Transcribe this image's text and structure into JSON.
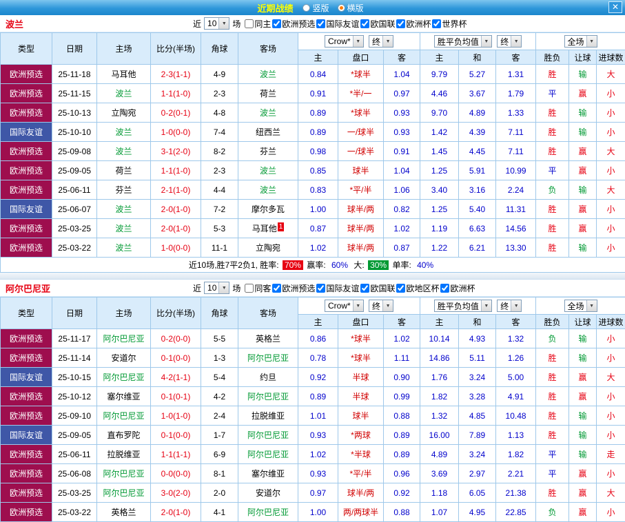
{
  "titlebar": {
    "title": "近期战绩",
    "vertical": "竖版",
    "horizontal": "横版",
    "close": "✕"
  },
  "table_head": {
    "col_type": "类型",
    "col_date": "日期",
    "col_home": "主场",
    "col_score": "比分(半场)",
    "col_corner": "角球",
    "col_away": "客场",
    "odds_select": "Crow*",
    "odds_final": "终",
    "avg_select": "胜平负均值",
    "avg_final": "终",
    "scope_select": "全场",
    "sub": [
      "主",
      "盘口",
      "客",
      "主",
      "和",
      "客",
      "胜负",
      "让球",
      "进球数"
    ]
  },
  "sections": [
    {
      "team": "波兰",
      "filter": {
        "near": "近",
        "count": "10",
        "games": "场",
        "checkboxes": [
          {
            "label": "同主",
            "checked": false
          },
          {
            "label": "欧洲预选",
            "checked": true
          },
          {
            "label": "国际友谊",
            "checked": true
          },
          {
            "label": "欧国联",
            "checked": true
          },
          {
            "label": "欧洲杯",
            "checked": true
          },
          {
            "label": "世界杯",
            "checked": true
          }
        ]
      },
      "rows": [
        {
          "type": "欧洲预选",
          "tc": "ep",
          "date": "25-11-18",
          "home": "马耳他",
          "hf": false,
          "score": "2-3(1-1)",
          "corner": "4-9",
          "away": "波兰",
          "af": true,
          "o1": "0.84",
          "oh": "*球半",
          "o2": "1.04",
          "e1": "9.79",
          "ex": "5.27",
          "e2": "1.31",
          "rs": "胜",
          "rsc": "red",
          "rh": "输",
          "rhc": "green",
          "rg": "大",
          "rgc": "red"
        },
        {
          "type": "欧洲预选",
          "tc": "ep",
          "date": "25-11-15",
          "home": "波兰",
          "hf": true,
          "score": "1-1(1-0)",
          "corner": "2-3",
          "away": "荷兰",
          "af": false,
          "o1": "0.91",
          "oh": "*半/一",
          "o2": "0.97",
          "e1": "4.46",
          "ex": "3.67",
          "e2": "1.79",
          "rs": "平",
          "rsc": "blue",
          "rh": "赢",
          "rhc": "red",
          "rg": "小",
          "rgc": "red"
        },
        {
          "type": "欧洲预选",
          "tc": "ep",
          "date": "25-10-13",
          "home": "立陶宛",
          "hf": false,
          "score": "0-2(0-1)",
          "corner": "4-8",
          "away": "波兰",
          "af": true,
          "o1": "0.89",
          "oh": "*球半",
          "o2": "0.93",
          "e1": "9.70",
          "ex": "4.89",
          "e2": "1.33",
          "rs": "胜",
          "rsc": "red",
          "rh": "输",
          "rhc": "green",
          "rg": "小",
          "rgc": "red"
        },
        {
          "type": "国际友谊",
          "tc": "if",
          "date": "25-10-10",
          "home": "波兰",
          "hf": true,
          "score": "1-0(0-0)",
          "corner": "7-4",
          "away": "纽西兰",
          "af": false,
          "o1": "0.89",
          "oh": "一/球半",
          "o2": "0.93",
          "e1": "1.42",
          "ex": "4.39",
          "e2": "7.11",
          "rs": "胜",
          "rsc": "red",
          "rh": "输",
          "rhc": "green",
          "rg": "小",
          "rgc": "red"
        },
        {
          "type": "欧洲预选",
          "tc": "ep",
          "date": "25-09-08",
          "home": "波兰",
          "hf": true,
          "score": "3-1(2-0)",
          "corner": "8-2",
          "away": "芬兰",
          "af": false,
          "o1": "0.98",
          "oh": "一/球半",
          "o2": "0.91",
          "e1": "1.45",
          "ex": "4.45",
          "e2": "7.11",
          "rs": "胜",
          "rsc": "red",
          "rh": "赢",
          "rhc": "red",
          "rg": "大",
          "rgc": "red"
        },
        {
          "type": "欧洲预选",
          "tc": "ep",
          "date": "25-09-05",
          "home": "荷兰",
          "hf": false,
          "score": "1-1(1-0)",
          "corner": "2-3",
          "away": "波兰",
          "af": true,
          "o1": "0.85",
          "oh": "球半",
          "o2": "1.04",
          "e1": "1.25",
          "ex": "5.91",
          "e2": "10.99",
          "rs": "平",
          "rsc": "blue",
          "rh": "赢",
          "rhc": "red",
          "rg": "小",
          "rgc": "red"
        },
        {
          "type": "欧洲预选",
          "tc": "ep",
          "date": "25-06-11",
          "home": "芬兰",
          "hf": false,
          "score": "2-1(1-0)",
          "corner": "4-4",
          "away": "波兰",
          "af": true,
          "o1": "0.83",
          "oh": "*平/半",
          "o2": "1.06",
          "e1": "3.40",
          "ex": "3.16",
          "e2": "2.24",
          "rs": "负",
          "rsc": "green",
          "rh": "输",
          "rhc": "green",
          "rg": "大",
          "rgc": "red"
        },
        {
          "type": "国际友谊",
          "tc": "if",
          "date": "25-06-07",
          "home": "波兰",
          "hf": true,
          "score": "2-0(1-0)",
          "corner": "7-2",
          "away": "摩尔多瓦",
          "af": false,
          "o1": "1.00",
          "oh": "球半/两",
          "o2": "0.82",
          "e1": "1.25",
          "ex": "5.40",
          "e2": "11.31",
          "rs": "胜",
          "rsc": "red",
          "rh": "赢",
          "rhc": "red",
          "rg": "小",
          "rgc": "red"
        },
        {
          "type": "欧洲预选",
          "tc": "ep",
          "date": "25-03-25",
          "home": "波兰",
          "hf": true,
          "score": "2-0(1-0)",
          "corner": "5-3",
          "away": "马耳他",
          "af": false,
          "ab": "1",
          "o1": "0.87",
          "oh": "球半/两",
          "o2": "1.02",
          "e1": "1.19",
          "ex": "6.63",
          "e2": "14.56",
          "rs": "胜",
          "rsc": "red",
          "rh": "赢",
          "rhc": "red",
          "rg": "小",
          "rgc": "red"
        },
        {
          "type": "欧洲预选",
          "tc": "ep",
          "date": "25-03-22",
          "home": "波兰",
          "hf": true,
          "score": "1-0(0-0)",
          "corner": "11-1",
          "away": "立陶宛",
          "af": false,
          "o1": "1.02",
          "oh": "球半/两",
          "o2": "0.87",
          "e1": "1.22",
          "ex": "6.21",
          "e2": "13.30",
          "rs": "胜",
          "rsc": "red",
          "rh": "输",
          "rhc": "green",
          "rg": "小",
          "rgc": "red"
        }
      ],
      "summary": {
        "prefix": "近10场,胜7平2负1, 胜率:",
        "win_rate": "70%",
        "mid1": "赢率:",
        "hcap_rate": "60%",
        "mid2": "大:",
        "big_rate": "30%",
        "mid3": "单率:",
        "odd_rate": "40%"
      }
    },
    {
      "team": "阿尔巴尼亚",
      "filter": {
        "near": "近",
        "count": "10",
        "games": "场",
        "checkboxes": [
          {
            "label": "同客",
            "checked": false
          },
          {
            "label": "欧洲预选",
            "checked": true
          },
          {
            "label": "国际友谊",
            "checked": true
          },
          {
            "label": "欧国联",
            "checked": true
          },
          {
            "label": "欧地区杯",
            "checked": true
          },
          {
            "label": "欧洲杯",
            "checked": true
          }
        ]
      },
      "rows": [
        {
          "type": "欧洲预选",
          "tc": "ep",
          "date": "25-11-17",
          "home": "阿尔巴尼亚",
          "hf": true,
          "score": "0-2(0-0)",
          "corner": "5-5",
          "away": "英格兰",
          "af": false,
          "o1": "0.86",
          "oh": "*球半",
          "o2": "1.02",
          "e1": "10.14",
          "ex": "4.93",
          "e2": "1.32",
          "rs": "负",
          "rsc": "green",
          "rh": "输",
          "rhc": "green",
          "rg": "小",
          "rgc": "red"
        },
        {
          "type": "欧洲预选",
          "tc": "ep",
          "date": "25-11-14",
          "home": "安道尔",
          "hf": false,
          "score": "0-1(0-0)",
          "corner": "1-3",
          "away": "阿尔巴尼亚",
          "af": true,
          "o1": "0.78",
          "oh": "*球半",
          "o2": "1.11",
          "e1": "14.86",
          "ex": "5.11",
          "e2": "1.26",
          "rs": "胜",
          "rsc": "red",
          "rh": "输",
          "rhc": "green",
          "rg": "小",
          "rgc": "red"
        },
        {
          "type": "国际友谊",
          "tc": "if",
          "date": "25-10-15",
          "home": "阿尔巴尼亚",
          "hf": true,
          "score": "4-2(1-1)",
          "corner": "5-4",
          "away": "约旦",
          "af": false,
          "o1": "0.92",
          "oh": "半球",
          "o2": "0.90",
          "e1": "1.76",
          "ex": "3.24",
          "e2": "5.00",
          "rs": "胜",
          "rsc": "red",
          "rh": "赢",
          "rhc": "red",
          "rg": "大",
          "rgc": "red"
        },
        {
          "type": "欧洲预选",
          "tc": "ep",
          "date": "25-10-12",
          "home": "塞尔维亚",
          "hf": false,
          "score": "0-1(0-1)",
          "corner": "4-2",
          "away": "阿尔巴尼亚",
          "af": true,
          "o1": "0.89",
          "oh": "半球",
          "o2": "0.99",
          "e1": "1.82",
          "ex": "3.28",
          "e2": "4.91",
          "rs": "胜",
          "rsc": "red",
          "rh": "赢",
          "rhc": "red",
          "rg": "小",
          "rgc": "red"
        },
        {
          "type": "欧洲预选",
          "tc": "ep",
          "date": "25-09-10",
          "home": "阿尔巴尼亚",
          "hf": true,
          "score": "1-0(1-0)",
          "corner": "2-4",
          "away": "拉脱维亚",
          "af": false,
          "o1": "1.01",
          "oh": "球半",
          "o2": "0.88",
          "e1": "1.32",
          "ex": "4.85",
          "e2": "10.48",
          "rs": "胜",
          "rsc": "red",
          "rh": "输",
          "rhc": "green",
          "rg": "小",
          "rgc": "red"
        },
        {
          "type": "国际友谊",
          "tc": "if",
          "date": "25-09-05",
          "home": "直布罗陀",
          "hf": false,
          "score": "0-1(0-0)",
          "corner": "1-7",
          "away": "阿尔巴尼亚",
          "af": true,
          "o1": "0.93",
          "oh": "*两球",
          "o2": "0.89",
          "e1": "16.00",
          "ex": "7.89",
          "e2": "1.13",
          "rs": "胜",
          "rsc": "red",
          "rh": "输",
          "rhc": "green",
          "rg": "小",
          "rgc": "red"
        },
        {
          "type": "欧洲预选",
          "tc": "ep",
          "date": "25-06-11",
          "home": "拉脱维亚",
          "hf": false,
          "score": "1-1(1-1)",
          "corner": "6-9",
          "away": "阿尔巴尼亚",
          "af": true,
          "o1": "1.02",
          "oh": "*半球",
          "o2": "0.89",
          "e1": "4.89",
          "ex": "3.24",
          "e2": "1.82",
          "rs": "平",
          "rsc": "blue",
          "rh": "输",
          "rhc": "green",
          "rg": "走",
          "rgc": "red"
        },
        {
          "type": "欧洲预选",
          "tc": "ep",
          "date": "25-06-08",
          "home": "阿尔巴尼亚",
          "hf": true,
          "score": "0-0(0-0)",
          "corner": "8-1",
          "away": "塞尔维亚",
          "af": false,
          "o1": "0.93",
          "oh": "*平/半",
          "o2": "0.96",
          "e1": "3.69",
          "ex": "2.97",
          "e2": "2.21",
          "rs": "平",
          "rsc": "blue",
          "rh": "赢",
          "rhc": "red",
          "rg": "小",
          "rgc": "red"
        },
        {
          "type": "欧洲预选",
          "tc": "ep",
          "date": "25-03-25",
          "home": "阿尔巴尼亚",
          "hf": true,
          "score": "3-0(2-0)",
          "corner": "2-0",
          "away": "安道尔",
          "af": false,
          "o1": "0.97",
          "oh": "球半/两",
          "o2": "0.92",
          "e1": "1.18",
          "ex": "6.05",
          "e2": "21.38",
          "rs": "胜",
          "rsc": "red",
          "rh": "赢",
          "rhc": "red",
          "rg": "大",
          "rgc": "red"
        },
        {
          "type": "欧洲预选",
          "tc": "ep",
          "date": "25-03-22",
          "home": "英格兰",
          "hf": false,
          "score": "2-0(1-0)",
          "corner": "4-1",
          "away": "阿尔巴尼亚",
          "af": true,
          "o1": "1.00",
          "oh": "两/两球半",
          "o2": "0.88",
          "e1": "1.07",
          "ex": "4.95",
          "e2": "22.85",
          "rs": "负",
          "rsc": "green",
          "rh": "赢",
          "rhc": "red",
          "rg": "小",
          "rgc": "red"
        }
      ]
    }
  ]
}
